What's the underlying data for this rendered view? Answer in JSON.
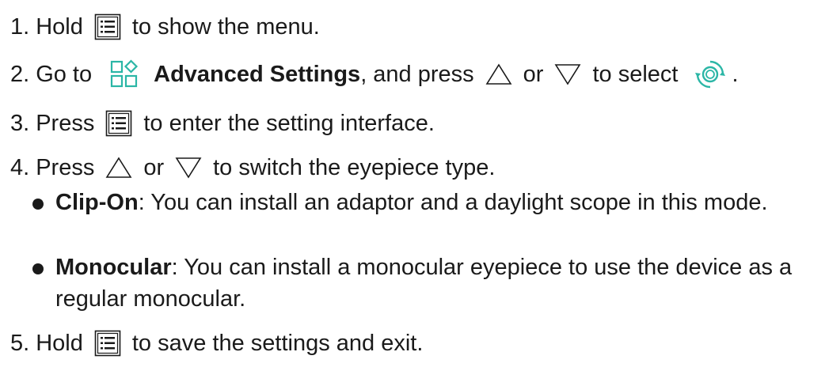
{
  "steps": [
    {
      "num": "1.",
      "before": "Hold",
      "after": "to show the menu."
    },
    {
      "num": "2.",
      "before": "Go to",
      "bold": "Advanced Settings",
      "mid": ", and press",
      "or": "or",
      "select": "to select",
      "end": "."
    },
    {
      "num": "3.",
      "before": "Press",
      "after": "to enter the setting interface."
    },
    {
      "num": "4.",
      "before": "Press",
      "or": "or",
      "after": "to switch the eyepiece type."
    },
    {
      "num": "5.",
      "before": "Hold",
      "after": "to save the settings and exit."
    }
  ],
  "bullets": [
    {
      "term": "Clip-On",
      "text": ": You can install an adaptor and a daylight scope in this mode."
    },
    {
      "term": "Monocular",
      "text": ": You can install a monocular eyepiece to use the device as a regular monocular."
    }
  ],
  "icons": {
    "menu": "menu-icon",
    "advanced_settings": "advanced-settings-icon",
    "up": "up-triangle-icon",
    "down": "down-triangle-icon",
    "eyepiece": "eyepiece-mode-icon"
  },
  "colors": {
    "text": "#1a1a1a",
    "accent": "#2bb6a6"
  }
}
